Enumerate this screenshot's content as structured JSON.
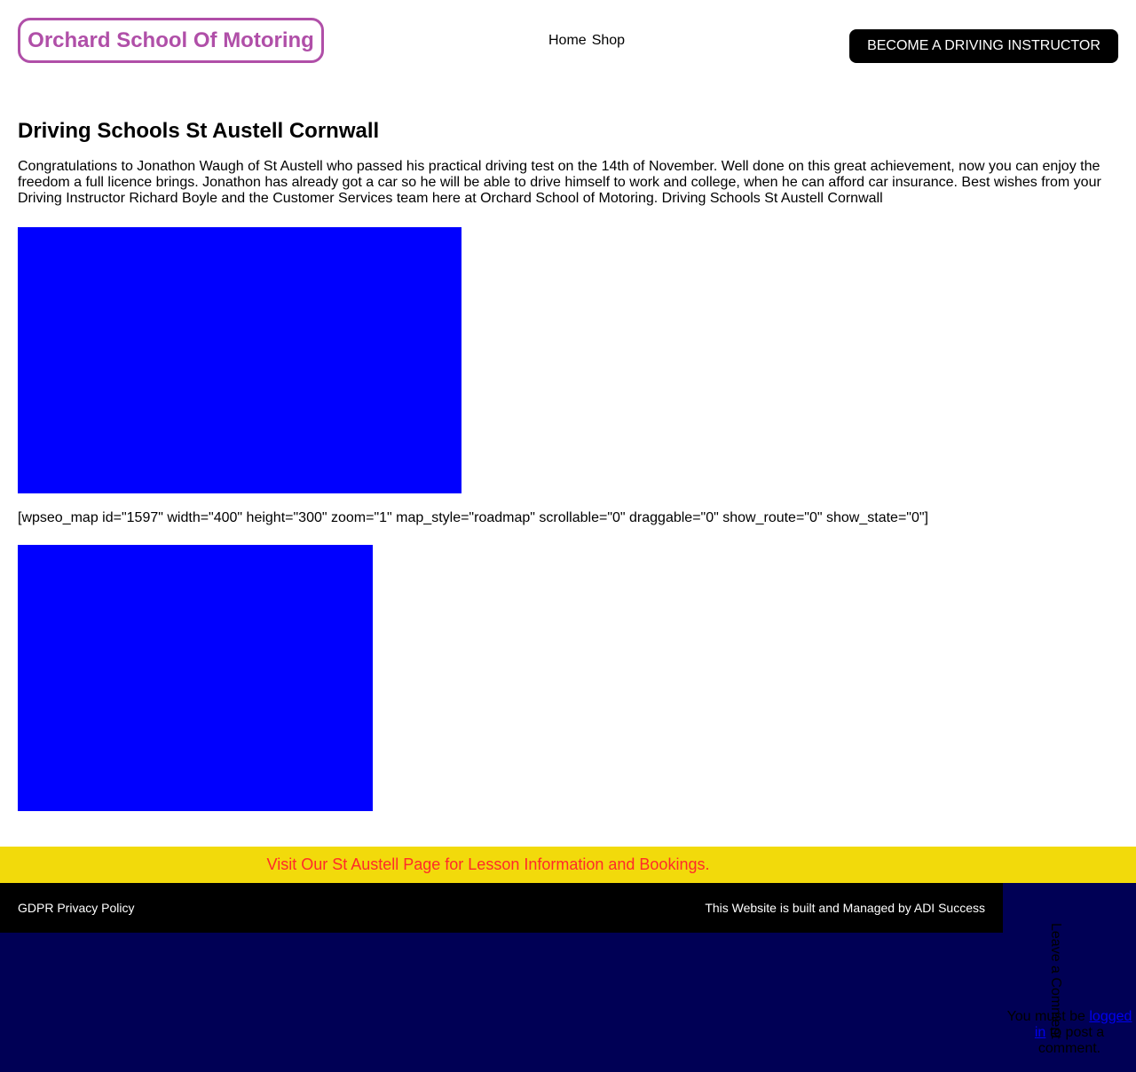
{
  "header": {
    "logo_text": "Orchard School Of Motoring",
    "nav": [
      "Home",
      "Shop"
    ],
    "cta_label": "BECOME A DRIVING INSTRUCTOR"
  },
  "main": {
    "title": "Driving Schools St Austell Cornwall",
    "body": "Congratulations to Jonathon Waugh of St Austell who passed his practical driving test on the 14th of November. Well done on this great achievement, now you can enjoy the freedom a full licence brings. Jonathon has already got a car so he will be able to drive himself to work and college, when he can afford car insurance. Best wishes from your Driving Instructor Richard Boyle and the Customer Services team here at Orchard School of Motoring. Driving Schools St Austell Cornwall",
    "shortcode": "[wpseo_map id=\"1597\" width=\"400\" height=\"300\" zoom=\"1\" map_style=\"roadmap\" scrollable=\"0\" draggable=\"0\" show_route=\"0\" show_state=\"0\"]"
  },
  "banner": {
    "text": "Visit Our St Austell Page for Lesson Information and Bookings."
  },
  "footer": {
    "left_link": "GDPR Privacy Policy",
    "right_text": "This Website is built and Managed by ADI Success"
  },
  "comments": {
    "title": "Leave a Comment",
    "note_prefix": "You must be",
    "note_link": "logged in",
    "note_suffix": "to post a comment."
  },
  "colors": {
    "logo": "#b04fa8",
    "image_placeholder": "#0000ff",
    "banner_bg": "#f2da0b",
    "banner_text": "#ff2a2a",
    "footer_bg": "#000055"
  }
}
